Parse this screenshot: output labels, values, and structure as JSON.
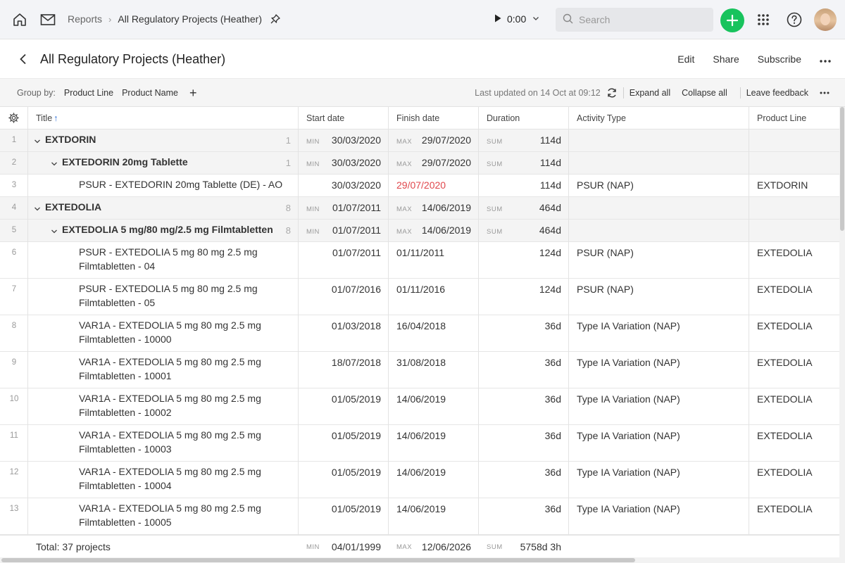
{
  "colors": {
    "accent": "#18c35d",
    "overdue": "#e0474c",
    "topbar_bg": "#f3f4f7"
  },
  "topbar": {
    "home_icon": "home-icon",
    "mail_icon": "mail-icon",
    "breadcrumb": {
      "parent": "Reports",
      "current": "All Regulatory Projects (Heather)"
    },
    "timer": "0:00",
    "search_placeholder": "Search",
    "add_icon": "plus-icon",
    "apps_icon": "grid-icon",
    "help_icon": "question-icon"
  },
  "page": {
    "title": "All Regulatory Projects (Heather)",
    "actions": {
      "edit": "Edit",
      "share": "Share",
      "subscribe": "Subscribe"
    }
  },
  "groupbar": {
    "label": "Group by:",
    "chips": [
      "Product Line",
      "Product Name"
    ],
    "add": "+",
    "last_updated": "Last updated on 14 Oct at 09:12",
    "expand_all": "Expand all",
    "collapse_all": "Collapse all",
    "leave_feedback": "Leave feedback"
  },
  "table": {
    "columns": {
      "title": "Title",
      "start": "Start date",
      "finish": "Finish date",
      "duration": "Duration",
      "activity": "Activity Type",
      "product_line": "Product Line"
    },
    "rows": [
      {
        "n": "1",
        "kind": "group1",
        "title": [
          "EXTDORIN"
        ],
        "count": "1",
        "start_agg": "MIN",
        "start": "30/03/2020",
        "finish_agg": "MAX",
        "finish": "29/07/2020",
        "dur_agg": "SUM",
        "duration": "114d",
        "activity": "",
        "product_line": ""
      },
      {
        "n": "2",
        "kind": "group2",
        "title": [
          "EXTEDORIN 20mg Tablette"
        ],
        "count": "1",
        "start_agg": "MIN",
        "start": "30/03/2020",
        "finish_agg": "MAX",
        "finish": "29/07/2020",
        "dur_agg": "SUM",
        "duration": "114d",
        "activity": "",
        "product_line": ""
      },
      {
        "n": "3",
        "kind": "item",
        "title": [
          "PSUR - EXTEDORIN 20mg Tablette (DE) - AO"
        ],
        "count": "",
        "start_agg": "",
        "start": "30/03/2020",
        "finish_agg": "",
        "finish": "29/07/2020",
        "finish_overdue": true,
        "dur_agg": "",
        "duration": "114d",
        "activity": "PSUR (NAP)",
        "product_line": "EXTDORIN"
      },
      {
        "n": "4",
        "kind": "group1",
        "title": [
          "EXTEDOLIA"
        ],
        "count": "8",
        "start_agg": "MIN",
        "start": "01/07/2011",
        "finish_agg": "MAX",
        "finish": "14/06/2019",
        "dur_agg": "SUM",
        "duration": "464d",
        "activity": "",
        "product_line": ""
      },
      {
        "n": "5",
        "kind": "group2",
        "title": [
          "EXTEDOLIA 5 mg/80 mg/2.5 mg Filmtabletten"
        ],
        "count": "8",
        "start_agg": "MIN",
        "start": "01/07/2011",
        "finish_agg": "MAX",
        "finish": "14/06/2019",
        "dur_agg": "SUM",
        "duration": "464d",
        "activity": "",
        "product_line": ""
      },
      {
        "n": "6",
        "kind": "item2",
        "title": [
          "PSUR - EXTEDOLIA 5 mg 80 mg 2.5 mg",
          "Filmtabletten - 04"
        ],
        "count": "",
        "start_agg": "",
        "start": "01/07/2011",
        "finish_agg": "",
        "finish": "01/11/2011",
        "dur_agg": "",
        "duration": "124d",
        "activity": "PSUR (NAP)",
        "product_line": "EXTEDOLIA"
      },
      {
        "n": "7",
        "kind": "item2",
        "title": [
          "PSUR - EXTEDOLIA 5 mg 80 mg 2.5 mg",
          "Filmtabletten - 05"
        ],
        "count": "",
        "start_agg": "",
        "start": "01/07/2016",
        "finish_agg": "",
        "finish": "01/11/2016",
        "dur_agg": "",
        "duration": "124d",
        "activity": "PSUR (NAP)",
        "product_line": "EXTEDOLIA"
      },
      {
        "n": "8",
        "kind": "item2",
        "title": [
          "VAR1A - EXTEDOLIA 5 mg 80 mg 2.5 mg",
          "Filmtabletten - 10000"
        ],
        "count": "",
        "start_agg": "",
        "start": "01/03/2018",
        "finish_agg": "",
        "finish": "16/04/2018",
        "dur_agg": "",
        "duration": "36d",
        "activity": "Type IA Variation (NAP)",
        "product_line": "EXTEDOLIA"
      },
      {
        "n": "9",
        "kind": "item2",
        "title": [
          "VAR1A - EXTEDOLIA 5 mg 80 mg 2.5 mg",
          "Filmtabletten - 10001"
        ],
        "count": "",
        "start_agg": "",
        "start": "18/07/2018",
        "finish_agg": "",
        "finish": "31/08/2018",
        "dur_agg": "",
        "duration": "36d",
        "activity": "Type IA Variation (NAP)",
        "product_line": "EXTEDOLIA"
      },
      {
        "n": "10",
        "kind": "item2",
        "title": [
          "VAR1A - EXTEDOLIA 5 mg 80 mg 2.5 mg",
          "Filmtabletten - 10002"
        ],
        "count": "",
        "start_agg": "",
        "start": "01/05/2019",
        "finish_agg": "",
        "finish": "14/06/2019",
        "dur_agg": "",
        "duration": "36d",
        "activity": "Type IA Variation (NAP)",
        "product_line": "EXTEDOLIA"
      },
      {
        "n": "11",
        "kind": "item2",
        "title": [
          "VAR1A - EXTEDOLIA 5 mg 80 mg 2.5 mg",
          "Filmtabletten - 10003"
        ],
        "count": "",
        "start_agg": "",
        "start": "01/05/2019",
        "finish_agg": "",
        "finish": "14/06/2019",
        "dur_agg": "",
        "duration": "36d",
        "activity": "Type IA Variation (NAP)",
        "product_line": "EXTEDOLIA"
      },
      {
        "n": "12",
        "kind": "item2",
        "title": [
          "VAR1A - EXTEDOLIA 5 mg 80 mg 2.5 mg",
          "Filmtabletten - 10004"
        ],
        "count": "",
        "start_agg": "",
        "start": "01/05/2019",
        "finish_agg": "",
        "finish": "14/06/2019",
        "dur_agg": "",
        "duration": "36d",
        "activity": "Type IA Variation (NAP)",
        "product_line": "EXTEDOLIA"
      },
      {
        "n": "13",
        "kind": "item2",
        "title": [
          "VAR1A - EXTEDOLIA 5 mg 80 mg 2.5 mg",
          "Filmtabletten - 10005"
        ],
        "count": "",
        "start_agg": "",
        "start": "01/05/2019",
        "finish_agg": "",
        "finish": "14/06/2019",
        "dur_agg": "",
        "duration": "36d",
        "activity": "Type IA Variation (NAP)",
        "product_line": "EXTEDOLIA"
      }
    ],
    "total": {
      "label": "Total: 37 projects",
      "start_agg": "MIN",
      "start": "04/01/1999",
      "finish_agg": "MAX",
      "finish": "12/06/2026",
      "dur_agg": "SUM",
      "duration": "5758d 3h"
    }
  }
}
